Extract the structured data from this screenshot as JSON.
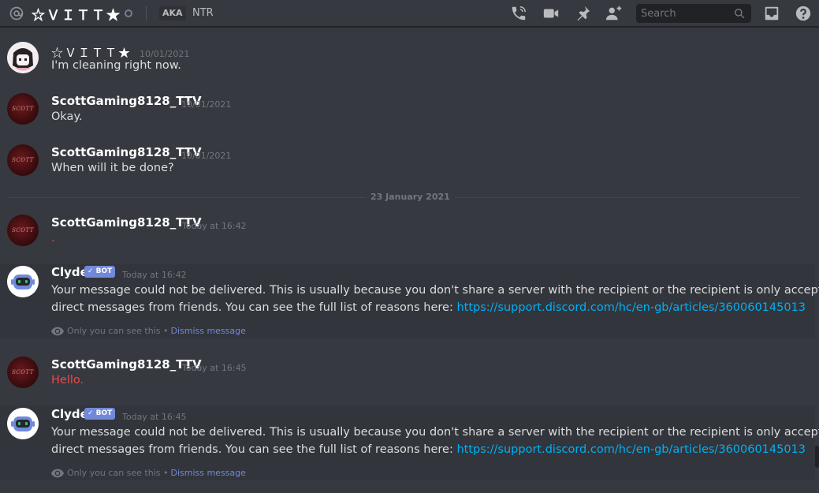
{
  "header": {
    "channel_name": "☆ＶＩＴＴ★",
    "aka_label": "AKA",
    "aka_name": "NTR",
    "search_placeholder": "Search"
  },
  "icons": {
    "at": "at-icon",
    "call": "phone-call-icon",
    "video": "video-icon",
    "pin": "pin-icon",
    "add_user": "add-friend-icon",
    "search": "search-icon",
    "inbox": "inbox-icon",
    "help": "help-icon",
    "eye": "eye-icon"
  },
  "colors": {
    "background": "#36393f",
    "link": "#00b0f4",
    "bot_badge": "#7289da",
    "error_red": "#f04747"
  },
  "date_divider": "23 January 2021",
  "messages": [
    {
      "author": "☆ＶＩＴＴ★",
      "time": "10/01/2021",
      "text": "I'm cleaning right now."
    },
    {
      "author": "ScottGaming8128_TTV",
      "time": "10/01/2021",
      "text": "Okay."
    },
    {
      "author": "ScottGaming8128_TTV",
      "time": "10/01/2021",
      "text": "When will it be done?"
    },
    {
      "author": "ScottGaming8128_TTV",
      "time": "Today at 16:42",
      "text": "."
    },
    {
      "author": "Clyde",
      "badge": "✓ BOT",
      "time": "Today at 16:42",
      "line1": "Your message could not be delivered. This is usually because you don't share a server with the recipient or the recipient is only accepting",
      "line2": "direct messages from friends. You can see the full list of reasons here: ",
      "link": "https://support.discord.com/hc/en-gb/articles/360060145013",
      "ephemeral": "Only you can see this •",
      "dismiss": "Dismiss message"
    },
    {
      "author": "ScottGaming8128_TTV",
      "time": "Today at 16:45",
      "text": "Hello."
    },
    {
      "author": "Clyde",
      "badge": "✓ BOT",
      "time": "Today at 16:45",
      "line1": "Your message could not be delivered. This is usually because you don't share a server with the recipient or the recipient is only accepting",
      "line2": "direct messages from friends. You can see the full list of reasons here: ",
      "link": "https://support.discord.com/hc/en-gb/articles/360060145013",
      "ephemeral": "Only you can see this •",
      "dismiss": "Dismiss message"
    }
  ]
}
